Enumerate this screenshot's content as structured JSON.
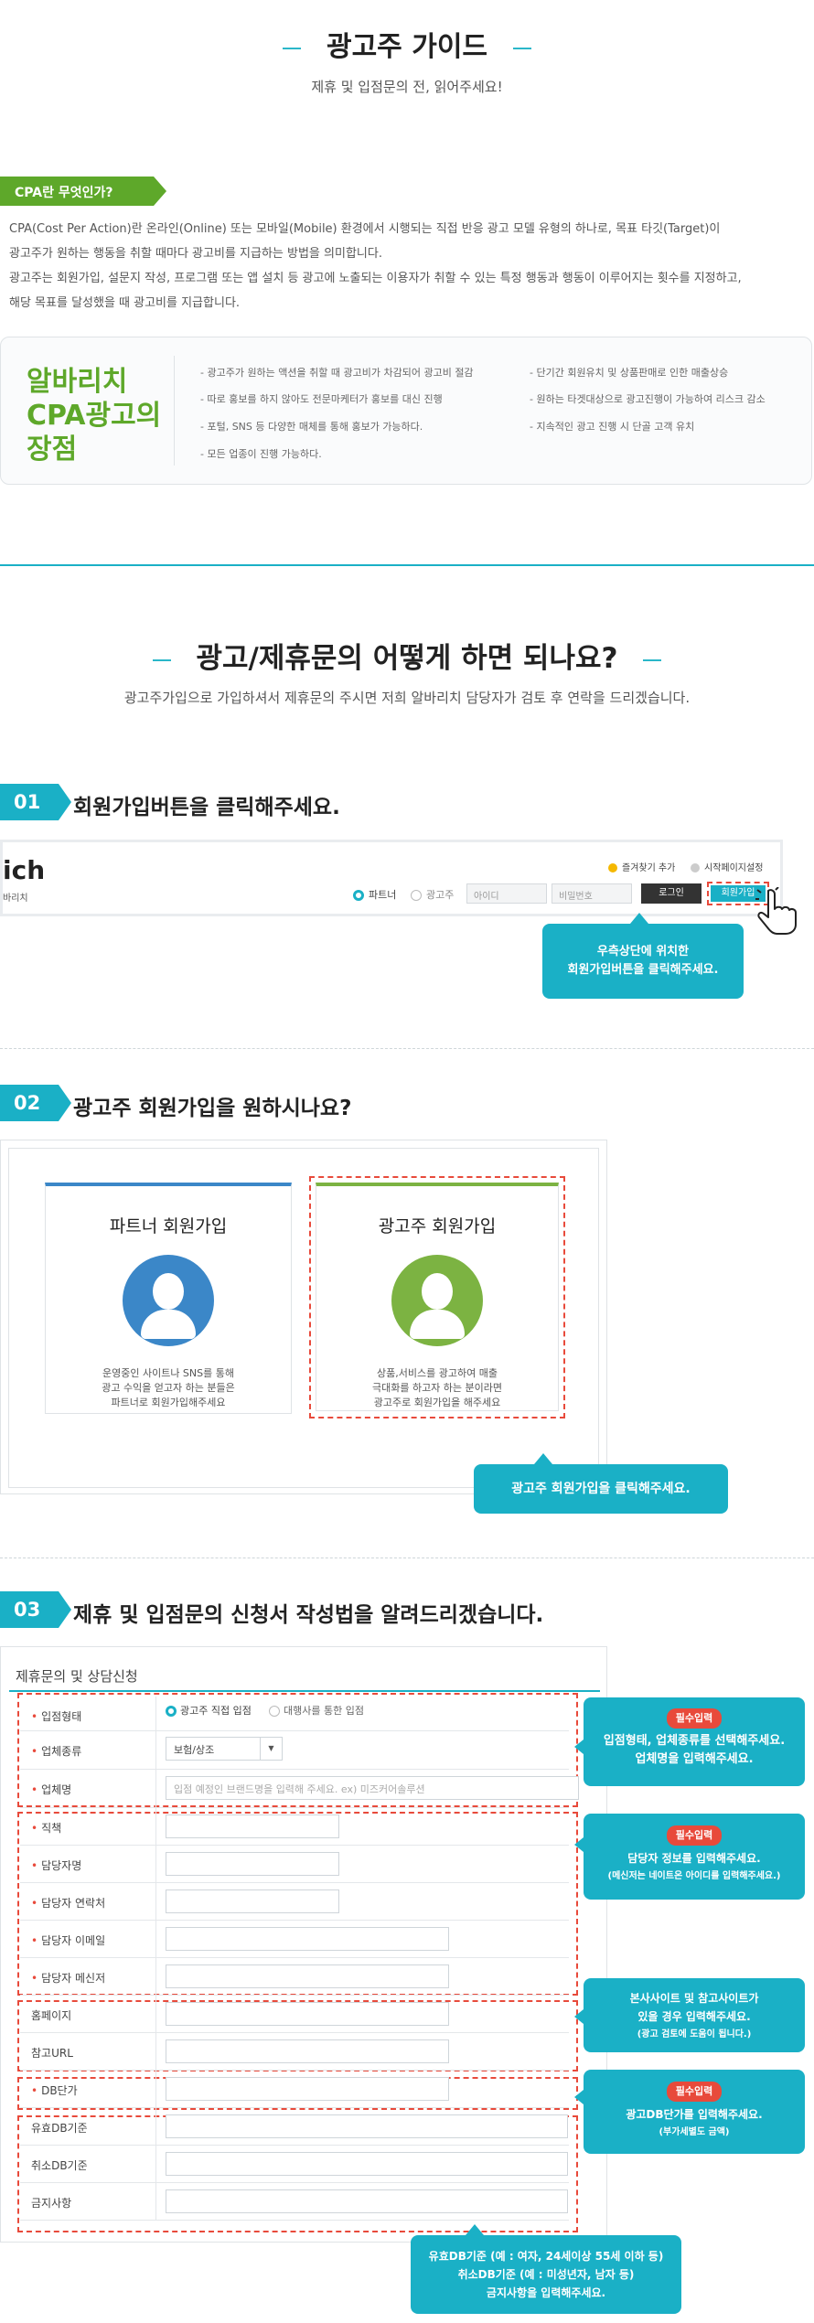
{
  "hero": {
    "title": "광고주 가이드",
    "subtitle": "제휴 및 입점문의 전, 읽어주세요!"
  },
  "cpa": {
    "tag": "CPA란 무엇인가?",
    "lines": [
      "CPA(Cost Per Action)란 온라인(Online) 또는 모바일(Mobile) 환경에서 시행되는 직접 반응 광고 모델 유형의 하나로, 목표 타깃(Target)이",
      "광고주가 원하는 행동을 취할 때마다 광고비를 지급하는 방법을 의미합니다.",
      "광고주는 회원가입, 설문지 작성, 프로그램 또는 앱 설치 등 광고에 노출되는 이용자가 취할 수 있는 특정 행동과 행동이 이루어지는 횟수를 지정하고,",
      "해당 목표를 달성했을 때 광고비를 지급합니다."
    ]
  },
  "advantages": {
    "title_lines": [
      "알바리치",
      "CPA광고의",
      "장점"
    ],
    "left": [
      "- 광고주가 원하는 액션을 취할 때 광고비가 차감되어 광고비 절감",
      "- 따로 홍보를 하지 않아도 전문마케터가 홍보를 대신 진행",
      "- 포털, SNS 등 다양한 매체를 통해 홍보가 가능하다.",
      "- 모든 업종이 진행 가능하다."
    ],
    "right": [
      "- 단기간 회원유치 및 상품판매로 인한 매출상승",
      "- 원하는 타겟대상으로 광고진행이 가능하여 리스크 감소",
      "- 지속적인 광고 진행 시 단골 고객 유치"
    ]
  },
  "howto": {
    "title": "광고/제휴문의 어떻게 하면 되나요?",
    "subtitle": "광고주가입으로 가입하셔서 제휴문의 주시면 저희 알바리치 담당자가 검토 후 연락을 드리겠습니다."
  },
  "step1": {
    "num": "01",
    "title": "회원가입버튼을 클릭해주세요.",
    "logo": "ich",
    "logo_sub": "바리치",
    "fav": "즐겨찾기 추가",
    "home": "시작페이지설정",
    "radio_partner": "파트너",
    "radio_advertiser": "광고주",
    "id_placeholder": "아이디",
    "pw_placeholder": "비밀번호",
    "login": "로그인",
    "join": "회원가입",
    "callout": [
      "우측상단에 위치한",
      "회원가입버튼을 클릭해주세요."
    ]
  },
  "step2": {
    "num": "02",
    "title": "광고주 회원가입을 원하시나요?",
    "partner": {
      "title": "파트너 회원가입",
      "desc": [
        "운영중인 사이트나 SNS를 통해",
        "광고 수익을 얻고자 하는 분들은",
        "파트너로 회원가입해주세요"
      ],
      "color": "#3b87c8"
    },
    "advertiser": {
      "title": "광고주 회원가입",
      "desc": [
        "상품,서비스를 광고하여 매출",
        "극대화를 하고자 하는 분이라면",
        "광고주로 회원가입을 해주세요"
      ],
      "color": "#7cb342"
    },
    "callout": "광고주 회원가입을 클릭해주세요."
  },
  "step3": {
    "num": "03",
    "title": "제휴 및 입점문의 신청서 작성법을 알려드리겠습니다.",
    "form_title": "제휴문의 및 상담신청",
    "rows": [
      {
        "label": "입점형태",
        "req": true
      },
      {
        "label": "업체종류",
        "req": true
      },
      {
        "label": "업체명",
        "req": true
      },
      {
        "label": "직책",
        "req": true
      },
      {
        "label": "담당자명",
        "req": true
      },
      {
        "label": "담당자 연락처",
        "req": true
      },
      {
        "label": "담당자 이메일",
        "req": true
      },
      {
        "label": "담당자 메신저",
        "req": true
      },
      {
        "label": "홈페이지",
        "req": false
      },
      {
        "label": "참고URL",
        "req": false
      },
      {
        "label": "DB단가",
        "req": true
      },
      {
        "label": "유효DB기준",
        "req": false
      },
      {
        "label": "취소DB기준",
        "req": false
      },
      {
        "label": "금지사항",
        "req": false
      }
    ],
    "radio_direct": "광고주 직접 입점",
    "radio_agency": "대행사를 통한 입점",
    "select_value": "보험/상조",
    "name_placeholder": "입점 예정인 브랜드명을 입력해 주세요. ex) 미즈커어솔루션",
    "callouts": {
      "c1": {
        "tag": "필수입력",
        "lines": [
          "입점형태, 업체종류를 선택해주세요.",
          "업체명을 입력해주세요."
        ]
      },
      "c2": {
        "tag": "필수입력",
        "lines": [
          "담당자 정보를 입력해주세요.",
          "(메신저는 네이트온 아이디를 입력해주세요.)"
        ]
      },
      "c3": {
        "lines": [
          "본사사이트 및 참고사이트가",
          "있을 경우 입력해주세요.",
          "(광고 검토에 도움이 됩니다.)"
        ]
      },
      "c4": {
        "tag": "필수입력",
        "lines": [
          "광고DB단가를 입력해주세요.",
          "(부가세별도 금액)"
        ]
      },
      "c5": {
        "lines": [
          "유효DB기준 (예 : 여자, 24세이상 55세 이하 등)",
          "취소DB기준 (예 : 미성년자, 남자 등)",
          "금지사항을 입력해주세요."
        ]
      }
    }
  },
  "colors": {
    "accent": "#1ab0c6",
    "green": "#5ea82a",
    "red": "#e84a3b"
  }
}
